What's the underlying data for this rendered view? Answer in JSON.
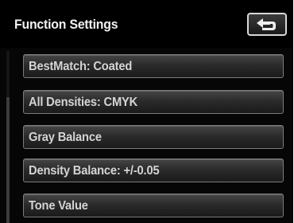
{
  "header": {
    "title": "Function Settings",
    "back_icon": "return-arrow-icon"
  },
  "menu": {
    "items": [
      {
        "label": "BestMatch: Coated"
      },
      {
        "label": "All Densities: CMYK"
      },
      {
        "label": "Gray Balance"
      },
      {
        "label": "Density Balance: +/-0.05"
      },
      {
        "label": "Tone Value"
      }
    ]
  },
  "colors": {
    "background": "#050505",
    "item_border": "#7c7c7c",
    "text": "#d4d4d4"
  }
}
